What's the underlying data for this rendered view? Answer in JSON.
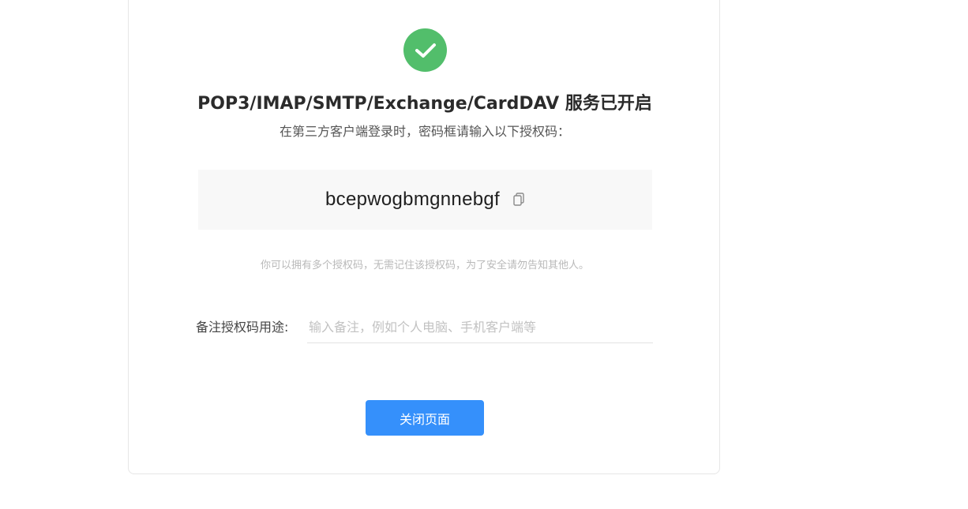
{
  "status": {
    "icon": "check-circle-icon",
    "color": "#52be6b"
  },
  "title": "POP3/IMAP/SMTP/Exchange/CardDAV 服务已开启",
  "subtitle": "在第三方客户端登录时，密码框请输入以下授权码：",
  "auth_code": {
    "value": "bcepwogbmgnnebgf",
    "copy_icon": "copy-icon"
  },
  "note": "你可以拥有多个授权码，无需记住该授权码，为了安全请勿告知其他人。",
  "remark": {
    "label": "备注授权码用途:",
    "placeholder": "输入备注，例如个人电脑、手机客户端等",
    "value": ""
  },
  "close_button": {
    "label": "关闭页面",
    "color": "#3590fb"
  }
}
